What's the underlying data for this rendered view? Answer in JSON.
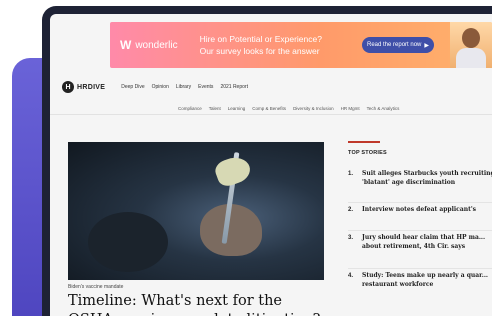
{
  "ad": {
    "logo_mark": "W",
    "logo_text": "wonderlic",
    "line1": "Hire on Potential or Experience?",
    "line2": "Our survey looks for the answer",
    "cta": "Read the report now",
    "cta_icon": "play-arrow-icon",
    "cta_arrow": "▶"
  },
  "header": {
    "brand_mark": "H",
    "brand_name": "HRDIVE",
    "nav": [
      "Deep Dive",
      "Opinion",
      "Library",
      "Events",
      "2021 Report"
    ],
    "subnav": [
      "Compliance",
      "Talent",
      "Learning",
      "Comp & Benefits",
      "Diversity & Inclusion",
      "HR Mgmt",
      "Tech & Analytics"
    ]
  },
  "article": {
    "kicker": "Biden's vaccine mandate",
    "headline": "Timeline: What's next for the OSHA vaccine mandate litigation?"
  },
  "top_stories": {
    "title": "TOP STORIES",
    "items": [
      {
        "num": "1.",
        "text": "Suit alleges Starbucks youth recruiting 'blatant' age discrimination"
      },
      {
        "num": "2.",
        "text": "Interview notes defeat applicant's"
      },
      {
        "num": "3.",
        "text": "Jury should hear claim that HP ma... about retirement, 4th Cir. says"
      },
      {
        "num": "4.",
        "text": "Study: Teens make up nearly a quar... restaurant workforce"
      }
    ]
  }
}
